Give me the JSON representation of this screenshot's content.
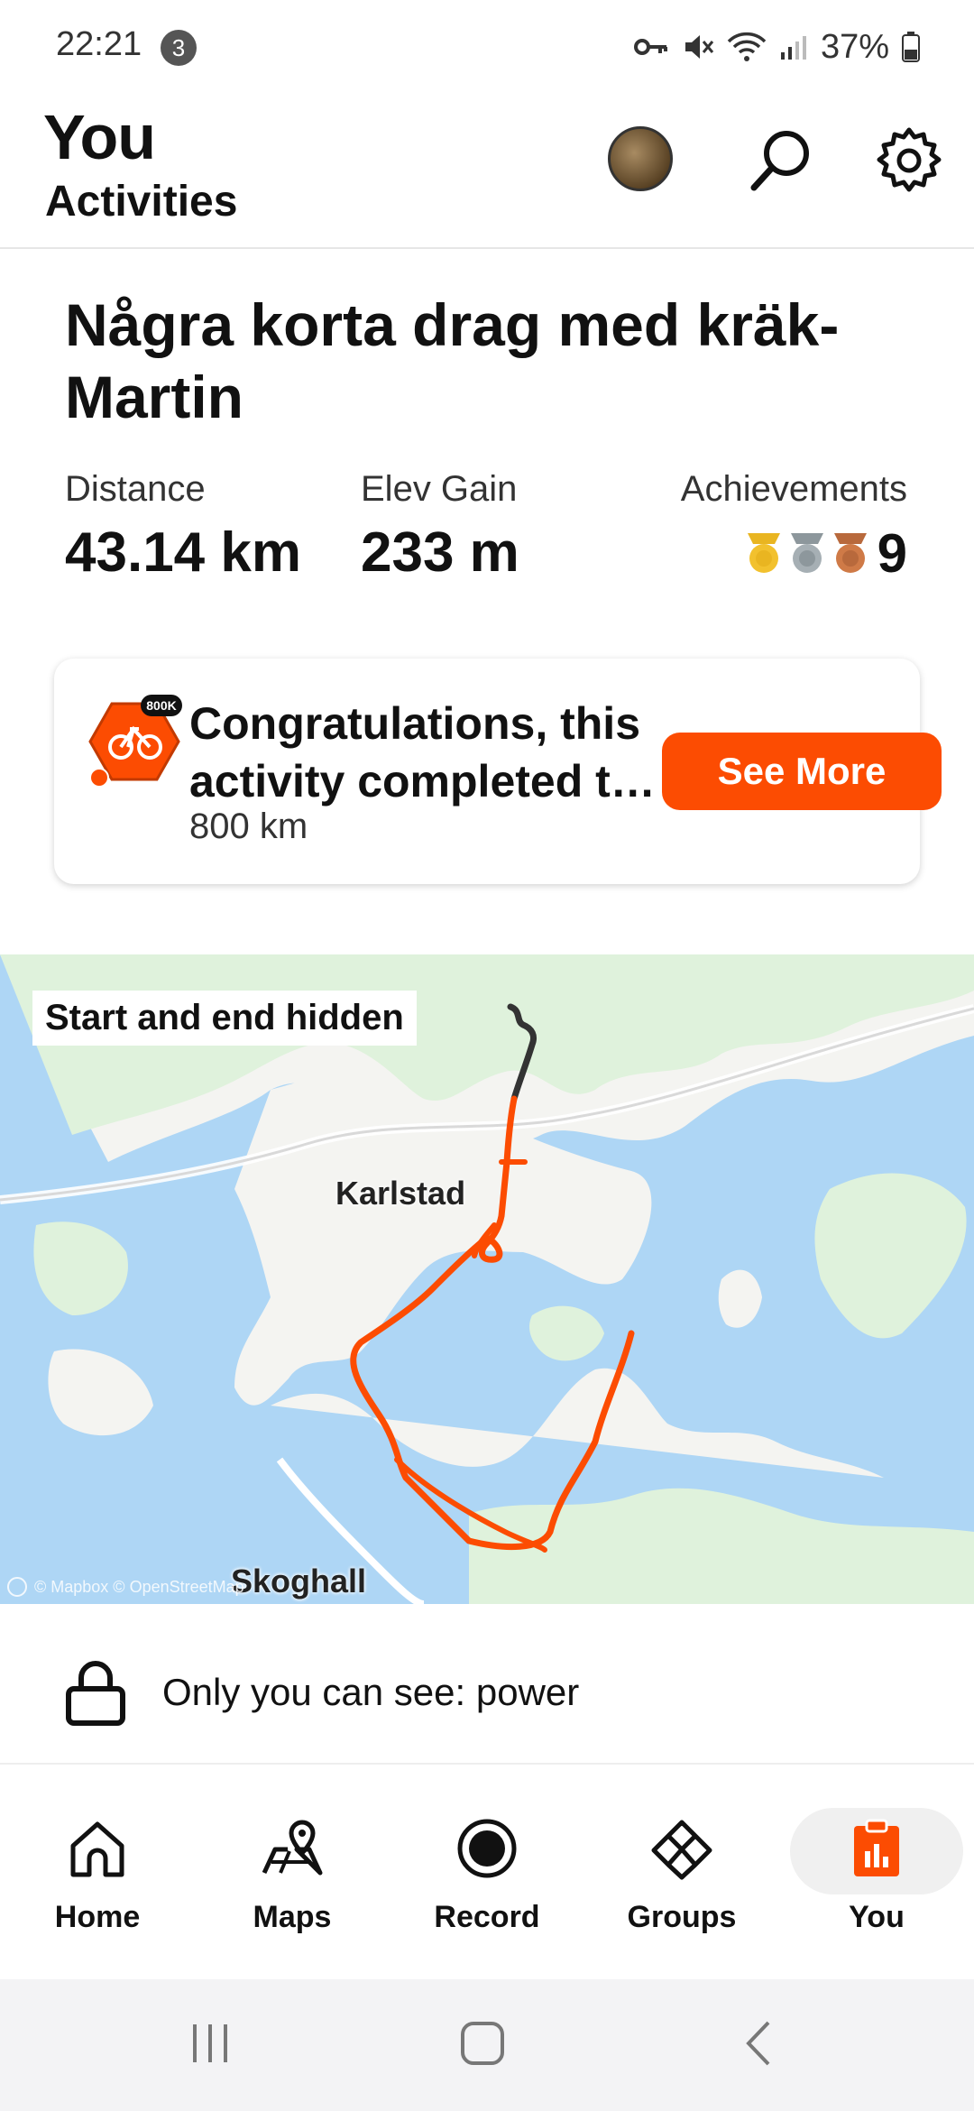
{
  "status_bar": {
    "time": "22:21",
    "notification_count": "3",
    "battery": "37%"
  },
  "header": {
    "title": "You",
    "subtitle": "Activities"
  },
  "activity": {
    "title": "Några korta drag med kräk-Martin",
    "stats": [
      {
        "label": "Distance",
        "value": "43.14 km"
      },
      {
        "label": "Elev Gain",
        "value": "233 m"
      }
    ],
    "achievements": {
      "label": "Achievements",
      "count": "9"
    }
  },
  "congrats_card": {
    "badge_text": "800K",
    "message": "Congratulations, this activity completed t…",
    "detail": "800 km",
    "button": "See More"
  },
  "map": {
    "notice": "Start and end hidden",
    "cities": [
      "Karlstad",
      "Skoghall"
    ],
    "attribution": "© Mapbox © OpenStreetMap",
    "route_color": "#fc4c02"
  },
  "privacy": {
    "text": "Only you can see: power"
  },
  "bottom_nav": {
    "items": [
      {
        "label": "Home",
        "icon": "home-icon"
      },
      {
        "label": "Maps",
        "icon": "maps-icon"
      },
      {
        "label": "Record",
        "icon": "record-icon"
      },
      {
        "label": "Groups",
        "icon": "groups-icon"
      },
      {
        "label": "You",
        "icon": "you-icon",
        "active": true
      }
    ]
  },
  "colors": {
    "accent": "#fc4c02",
    "water": "#aed6f5",
    "land": "#f4f4f1"
  }
}
